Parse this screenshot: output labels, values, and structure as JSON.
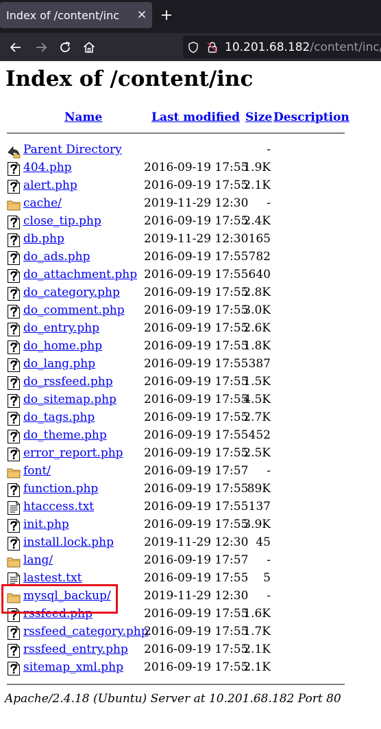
{
  "browser": {
    "tab_title": "Index of /content/inc",
    "url_host": "10.201.68.182",
    "url_path": "/content/inc/"
  },
  "page": {
    "title": "Index of /content/inc",
    "columns": {
      "name": "Name",
      "modified": "Last modified",
      "size": "Size",
      "description": "Description"
    },
    "parent": {
      "label": "Parent Directory",
      "size": "-"
    },
    "entries": [
      {
        "name": "404.php",
        "modified": "2016-09-19 17:55",
        "size": "1.9K",
        "type": "php"
      },
      {
        "name": "alert.php",
        "modified": "2016-09-19 17:55",
        "size": "2.1K",
        "type": "php"
      },
      {
        "name": "cache/",
        "modified": "2019-11-29 12:30",
        "size": "-",
        "type": "folder"
      },
      {
        "name": "close_tip.php",
        "modified": "2016-09-19 17:55",
        "size": "2.4K",
        "type": "php"
      },
      {
        "name": "db.php",
        "modified": "2019-11-29 12:30",
        "size": "165",
        "type": "php"
      },
      {
        "name": "do_ads.php",
        "modified": "2016-09-19 17:55",
        "size": "782",
        "type": "php"
      },
      {
        "name": "do_attachment.php",
        "modified": "2016-09-19 17:55",
        "size": "640",
        "type": "php"
      },
      {
        "name": "do_category.php",
        "modified": "2016-09-19 17:55",
        "size": "2.8K",
        "type": "php"
      },
      {
        "name": "do_comment.php",
        "modified": "2016-09-19 17:55",
        "size": "3.0K",
        "type": "php"
      },
      {
        "name": "do_entry.php",
        "modified": "2016-09-19 17:55",
        "size": "2.6K",
        "type": "php"
      },
      {
        "name": "do_home.php",
        "modified": "2016-09-19 17:55",
        "size": "1.8K",
        "type": "php"
      },
      {
        "name": "do_lang.php",
        "modified": "2016-09-19 17:55",
        "size": "387",
        "type": "php"
      },
      {
        "name": "do_rssfeed.php",
        "modified": "2016-09-19 17:55",
        "size": "1.5K",
        "type": "php"
      },
      {
        "name": "do_sitemap.php",
        "modified": "2016-09-19 17:55",
        "size": "4.5K",
        "type": "php"
      },
      {
        "name": "do_tags.php",
        "modified": "2016-09-19 17:55",
        "size": "2.7K",
        "type": "php"
      },
      {
        "name": "do_theme.php",
        "modified": "2016-09-19 17:55",
        "size": "452",
        "type": "php"
      },
      {
        "name": "error_report.php",
        "modified": "2016-09-19 17:55",
        "size": "2.5K",
        "type": "php"
      },
      {
        "name": "font/",
        "modified": "2016-09-19 17:57",
        "size": "-",
        "type": "folder"
      },
      {
        "name": "function.php",
        "modified": "2016-09-19 17:55",
        "size": "89K",
        "type": "php"
      },
      {
        "name": "htaccess.txt",
        "modified": "2016-09-19 17:55",
        "size": "137",
        "type": "text"
      },
      {
        "name": "init.php",
        "modified": "2016-09-19 17:55",
        "size": "3.9K",
        "type": "php"
      },
      {
        "name": "install.lock.php",
        "modified": "2019-11-29 12:30",
        "size": "45",
        "type": "php"
      },
      {
        "name": "lang/",
        "modified": "2016-09-19 17:57",
        "size": "-",
        "type": "folder"
      },
      {
        "name": "lastest.txt",
        "modified": "2016-09-19 17:55",
        "size": "5",
        "type": "text"
      },
      {
        "name": "mysql_backup/",
        "modified": "2019-11-29 12:30",
        "size": "-",
        "type": "folder"
      },
      {
        "name": "rssfeed.php",
        "modified": "2016-09-19 17:55",
        "size": "1.6K",
        "type": "php"
      },
      {
        "name": "rssfeed_category.php",
        "modified": "2016-09-19 17:55",
        "size": "1.7K",
        "type": "php"
      },
      {
        "name": "rssfeed_entry.php",
        "modified": "2016-09-19 17:55",
        "size": "2.1K",
        "type": "php"
      },
      {
        "name": "sitemap_xml.php",
        "modified": "2016-09-19 17:55",
        "size": "2.1K",
        "type": "php"
      }
    ],
    "address": "Apache/2.4.18 (Ubuntu) Server at 10.201.68.182 Port 80"
  },
  "colors": {
    "link": "#0000ee",
    "highlight": "#e8101a",
    "tab_bg": "#42414d",
    "chrome_bg": "#1c1b22"
  }
}
